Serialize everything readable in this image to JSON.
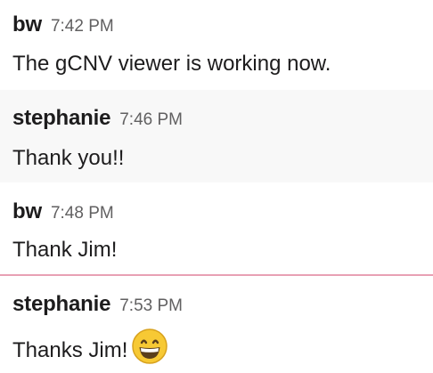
{
  "messages": [
    {
      "author": "bw",
      "time": "7:42 PM",
      "text": "The gCNV viewer is working now."
    },
    {
      "author": "stephanie",
      "time": "7:46 PM",
      "text": "Thank you!!"
    },
    {
      "author": "bw",
      "time": "7:48 PM",
      "text": "Thank Jim!"
    },
    {
      "author": "stephanie",
      "time": "7:53 PM",
      "text": "Thanks Jim!",
      "emoji": "grinning-face-icon"
    }
  ],
  "colors": {
    "hover_background": "#f8f8f8",
    "divider": "#e8a0b4",
    "timestamp": "#616061"
  }
}
